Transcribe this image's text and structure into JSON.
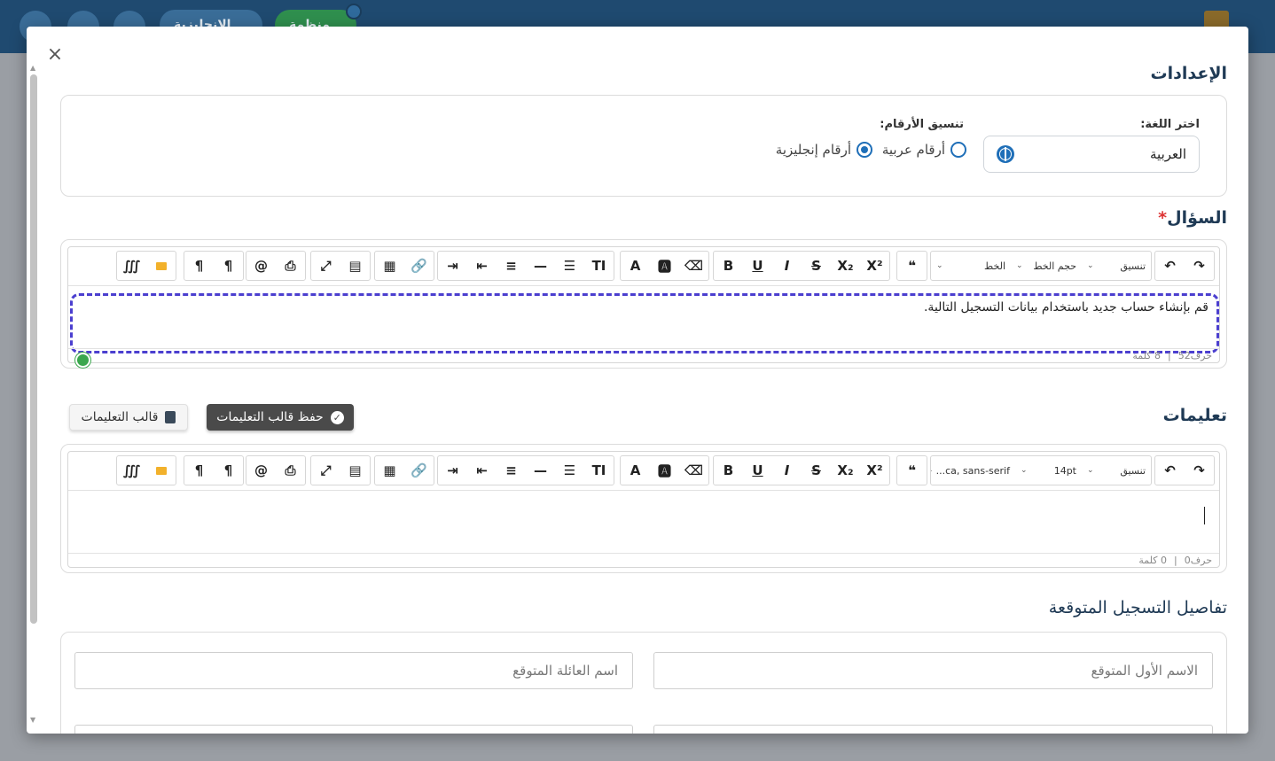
{
  "app": {
    "header_lang_label": "الإنجليزية",
    "header_status_label": "منظمة"
  },
  "modal": {
    "close_icon": "close-icon",
    "settings": {
      "title": "الإعدادات",
      "language_label": "اختر اللغة:",
      "language_value": "العربية",
      "number_format_label": "تنسيق الأرقام:",
      "radio_arabic": "أرقام عربية",
      "radio_english": "أرقام إنجليزية",
      "selected": "english"
    },
    "question": {
      "title": "السؤال",
      "required_mark": "*",
      "text": "قم بإنشاء حساب جديد باستخدام بيانات التسجيل التالية.",
      "chars": "حرف52",
      "words": "8 كلمة",
      "toolbar": {
        "format_label": "تنسيق",
        "fontsize_label": "حجم الخط",
        "font_label": "الخط"
      }
    },
    "instructions": {
      "title": "تعليمات",
      "save_template_button": "حفظ قالب التعليمات",
      "template_button": "قالب التعليمات",
      "chars": "حرف0",
      "words": "0 كلمة",
      "toolbar": {
        "format_label": "تنسيق",
        "fontsize_label": "14pt",
        "font_label": "...ca, sans-serif"
      }
    },
    "registration": {
      "title": "تفاصيل التسجيل المتوقعة",
      "first_name_placeholder": "الاسم الأول المتوقع",
      "last_name_placeholder": "اسم العائلة المتوقع"
    },
    "separator": "|"
  }
}
